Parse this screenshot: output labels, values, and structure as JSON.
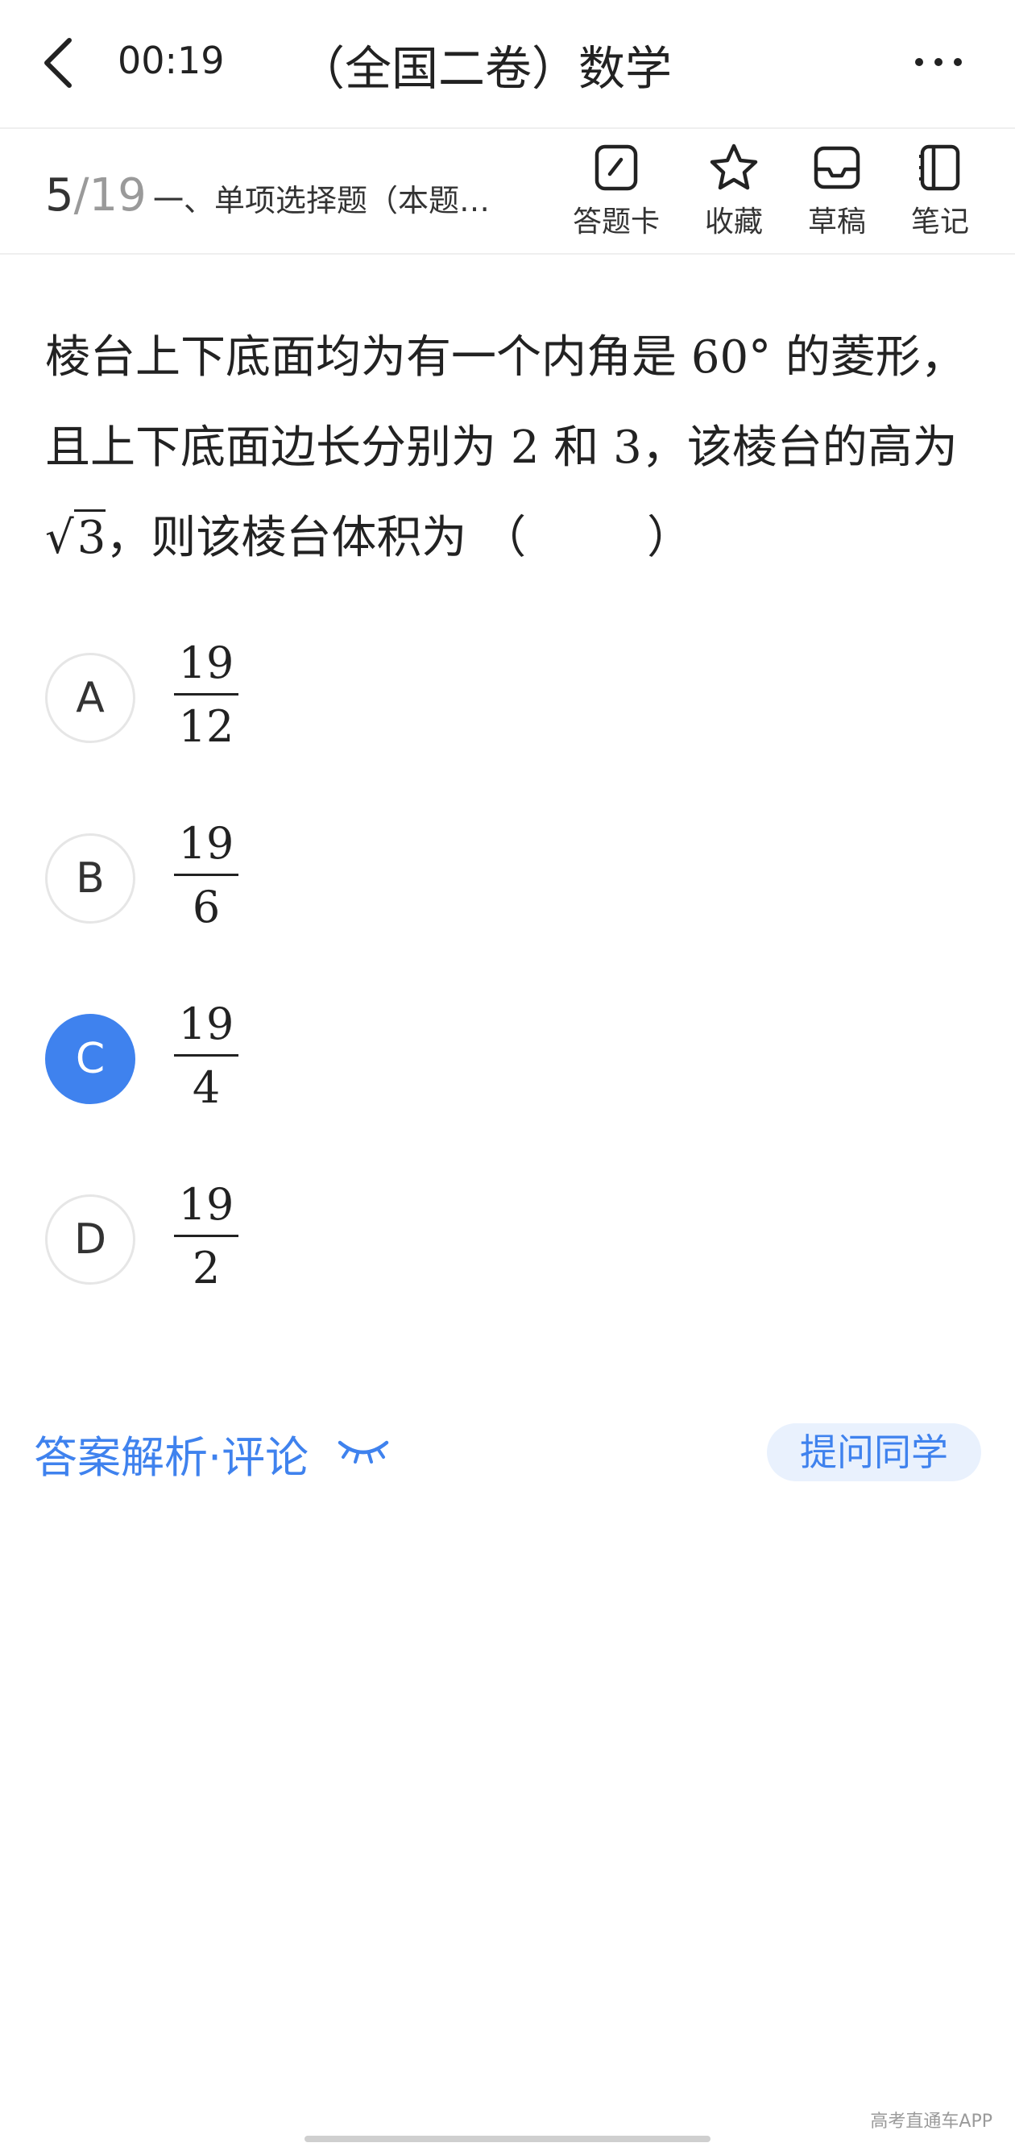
{
  "header": {
    "timer": "00:19",
    "title": "（全国二卷）数学"
  },
  "subheader": {
    "current": "5",
    "separator": "/",
    "total": "19",
    "section_title": "一、单项选择题（本题…",
    "tools": [
      {
        "label": "答题卡",
        "icon": "answer-card-icon"
      },
      {
        "label": "收藏",
        "icon": "star-icon"
      },
      {
        "label": "草稿",
        "icon": "draft-tray-icon"
      },
      {
        "label": "笔记",
        "icon": "notebook-icon"
      }
    ]
  },
  "question": {
    "t1": "棱台上下底面均为有一个内角是",
    "deg": "60°",
    "t2": "的菱形，且上下底面边长分别为",
    "n2": "2",
    "t3": "和",
    "n3": "3",
    "t4": "，该棱台的高为",
    "sqrt_sym": "√",
    "sqrt_arg": "3",
    "t5": "，则该棱台体积为",
    "paren_open": "（",
    "paren_close": "）"
  },
  "options": [
    {
      "letter": "A",
      "num": "19",
      "den": "12",
      "selected": false
    },
    {
      "letter": "B",
      "num": "19",
      "den": "6",
      "selected": false
    },
    {
      "letter": "C",
      "num": "19",
      "den": "4",
      "selected": true
    },
    {
      "letter": "D",
      "num": "19",
      "den": "2",
      "selected": false
    }
  ],
  "footer": {
    "analysis": "答案解析·评论",
    "ask": "提问同学",
    "watermark": "高考直通车APP"
  },
  "colors": {
    "accent": "#3f82ee",
    "accent_bg": "#e9f1fd"
  }
}
